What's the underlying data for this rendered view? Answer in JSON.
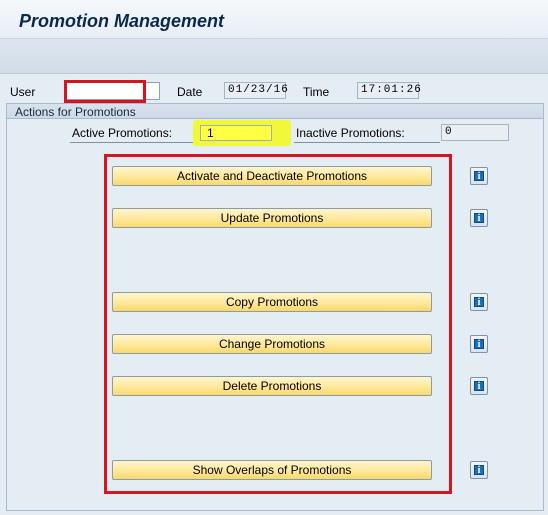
{
  "window": {
    "title": "Promotion Management"
  },
  "header": {
    "user_label": "User",
    "user_value": "",
    "date_label": "Date",
    "date_value": "01/23/16",
    "time_label": "Time",
    "time_value": "17:01:26"
  },
  "group": {
    "title": "Actions for Promotions",
    "active_label": "Active Promotions:",
    "active_value": "1",
    "inactive_label": "Inactive Promotions:",
    "inactive_value": "0"
  },
  "actions": [
    {
      "label": "Activate and Deactivate Promotions",
      "icon": "info-icon"
    },
    {
      "label": "Update Promotions",
      "icon": "info-icon"
    },
    {
      "label": "Copy Promotions",
      "icon": "info-icon"
    },
    {
      "label": "Change Promotions",
      "icon": "info-icon"
    },
    {
      "label": "Delete Promotions",
      "icon": "info-icon"
    },
    {
      "label": "Show Overlaps of Promotions",
      "icon": "info-icon"
    }
  ],
  "colors": {
    "highlight_red": "#d8121f",
    "highlight_yellow": "#ffff44",
    "button_yellow": "#ffe89b"
  }
}
